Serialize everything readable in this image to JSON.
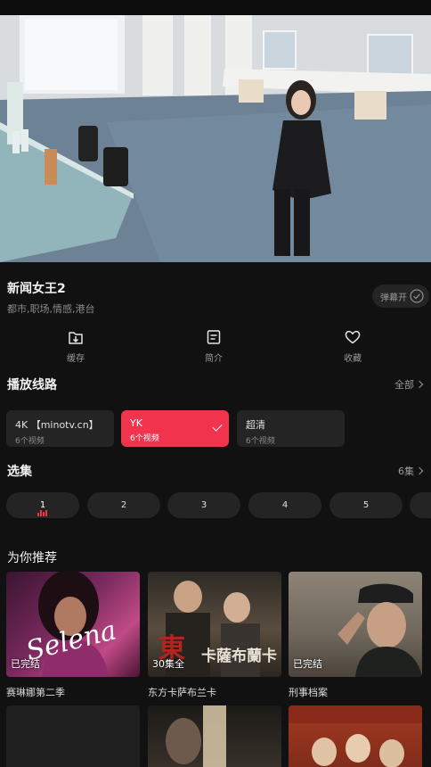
{
  "show": {
    "title": "新闻女王2",
    "tags": "都市,职场,情感,港台",
    "danmu_label": "弹幕开"
  },
  "actions": [
    {
      "label": "缓存",
      "icon": "download-icon"
    },
    {
      "label": "简介",
      "icon": "document-icon"
    },
    {
      "label": "收藏",
      "icon": "heart-icon"
    }
  ],
  "sources_section": {
    "title": "播放线路",
    "more": "全部",
    "items": [
      {
        "name": "4K 【minotv.cn】",
        "count": "6个视频",
        "active": false
      },
      {
        "name": "YK",
        "count": "6个视频",
        "active": true
      },
      {
        "name": "超清",
        "count": "6个视频",
        "active": false
      }
    ]
  },
  "episodes_section": {
    "title": "选集",
    "more": "6集",
    "items": [
      "1",
      "2",
      "3",
      "4",
      "5"
    ],
    "active_index": 0
  },
  "recommend_section": {
    "title": "为你推荐",
    "items": [
      {
        "name": "赛琳娜第二季",
        "badge": "已完结",
        "poster_text": "Selena"
      },
      {
        "name": "东方卡萨布兰卡",
        "badge": "30集全",
        "poster_text": "卡薩布蘭卡"
      },
      {
        "name": "刑事档案",
        "badge": "已完结",
        "poster_text": ""
      }
    ]
  },
  "colors": {
    "accent": "#f2334e",
    "background": "#111112",
    "surface": "#242424"
  }
}
